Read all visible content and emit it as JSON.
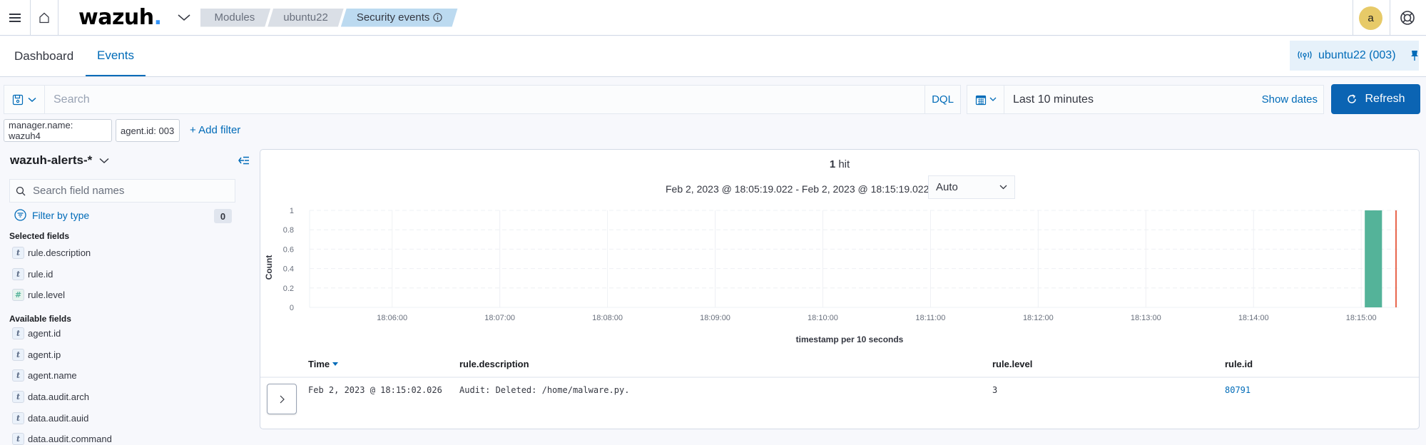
{
  "topbar": {
    "logo": "wazuh",
    "logo_dot": ".",
    "breadcrumbs": [
      "Modules",
      "ubuntu22",
      "Security events"
    ],
    "avatar_initial": "a",
    "icons": [
      "menu-icon",
      "home-icon",
      "chevron-down-icon",
      "info-icon",
      "help-icon"
    ]
  },
  "tabs": [
    {
      "label": "Dashboard",
      "active": false
    },
    {
      "label": "Events",
      "active": true
    }
  ],
  "agent_pill": {
    "label": "ubuntu22 (003)"
  },
  "search": {
    "placeholder": "Search",
    "value": "",
    "language": "DQL"
  },
  "date_picker": {
    "value": "Last 10 minutes",
    "show_dates_label": "Show dates"
  },
  "refresh_label": "Refresh",
  "filters": [
    {
      "label": "manager.name: wazuh4"
    },
    {
      "label": "agent.id: 003"
    }
  ],
  "add_filter_label": "+ Add filter",
  "sidebar": {
    "index_pattern": "wazuh-alerts-*",
    "field_search_placeholder": "Search field names",
    "filter_by_type_label": "Filter by type",
    "filter_count": "0",
    "selected_title": "Selected fields",
    "selected_fields": [
      {
        "name": "rule.description",
        "type": "t"
      },
      {
        "name": "rule.id",
        "type": "t"
      },
      {
        "name": "rule.level",
        "type": "#"
      }
    ],
    "available_title": "Available fields",
    "available_fields": [
      {
        "name": "agent.id",
        "type": "t"
      },
      {
        "name": "agent.ip",
        "type": "t"
      },
      {
        "name": "agent.name",
        "type": "t"
      },
      {
        "name": "data.audit.arch",
        "type": "t"
      },
      {
        "name": "data.audit.auid",
        "type": "t"
      },
      {
        "name": "data.audit.command",
        "type": "t"
      }
    ]
  },
  "results": {
    "hit_count": "1",
    "hit_label": "hit",
    "time_range": "Feb 2, 2023 @ 18:05:19.022 - Feb 2, 2023 @ 18:15:19.022",
    "interval": "Auto"
  },
  "chart_data": {
    "type": "bar",
    "title": "",
    "xlabel": "timestamp per 10 seconds",
    "ylabel": "Count",
    "x_range": [
      "18:05:19",
      "18:15:19"
    ],
    "ylim": [
      0,
      1
    ],
    "yticks": [
      "0",
      "0.2",
      "0.4",
      "0.6",
      "0.8",
      "1"
    ],
    "xticks": [
      "18:06:00",
      "18:07:00",
      "18:08:00",
      "18:09:00",
      "18:10:00",
      "18:11:00",
      "18:12:00",
      "18:13:00",
      "18:14:00",
      "18:15:00"
    ],
    "bucket_seconds": 10,
    "series": [
      {
        "name": "Count",
        "color": "#54b399",
        "points": [
          {
            "x": "18:15:00",
            "y": 1
          }
        ]
      }
    ],
    "now_marker": {
      "x": "18:15:19",
      "color": "#e7664c"
    },
    "grid": true,
    "legend": "none"
  },
  "table": {
    "columns": [
      "Time",
      "rule.description",
      "rule.level",
      "rule.id"
    ],
    "rows": [
      {
        "time": "Feb 2, 2023 @ 18:15:02.026",
        "description": "Audit: Deleted: /home/malware.py.",
        "level": "3",
        "id": "80791"
      }
    ]
  },
  "colors": {
    "accent": "#006bb8",
    "refresh_bg": "#0b64b3",
    "bar": "#54b399",
    "now_line": "#e7664c",
    "avatar": "#e7ca68",
    "crumb_active": "#bcdaf0"
  }
}
